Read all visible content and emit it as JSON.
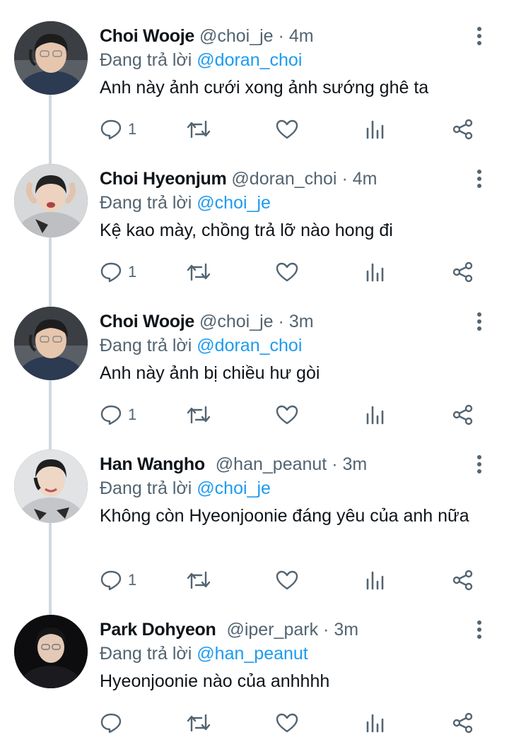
{
  "reply_prefix": "Đang trả lời",
  "dot": "·",
  "tweets": [
    {
      "name": "Choi Wooje",
      "handle": "@choi_je",
      "time": "4m",
      "reply_to": "@doran_choi",
      "text": "Anh này ảnh cưới xong ảnh sướng ghê ta",
      "reply_count": "1"
    },
    {
      "name": "Choi Hyeonjum",
      "handle": "@doran_choi",
      "time": "4m",
      "reply_to": "@choi_je",
      "text": "Kệ kao mày, chồng trả lỡ nào hong đi",
      "reply_count": "1"
    },
    {
      "name": "Choi Wooje",
      "handle": "@choi_je",
      "time": "3m",
      "reply_to": "@doran_choi",
      "text": "Anh này ảnh bị chiều hư gòi",
      "reply_count": "1"
    },
    {
      "name": "Han Wangho",
      "handle": "@han_peanut",
      "time": "3m",
      "reply_to": "@choi_je",
      "text": "Không còn Hyeonjoonie đáng yêu của anh nữa",
      "reply_count": "1"
    },
    {
      "name": "Park Dohyeon",
      "handle": "@iper_park",
      "time": "3m",
      "reply_to": "@han_peanut",
      "text": "Hyeonjoonie nào của anhhhh",
      "reply_count": ""
    }
  ],
  "icons": {
    "reply": "reply-icon",
    "retweet": "retweet-icon",
    "like": "like-icon",
    "views": "views-icon",
    "share": "share-icon",
    "more": "more-vertical-icon"
  },
  "colors": {
    "name": "#0f1419",
    "secondary": "#536471",
    "mention": "#1d9bf0",
    "thread_line": "#cfd9de"
  }
}
